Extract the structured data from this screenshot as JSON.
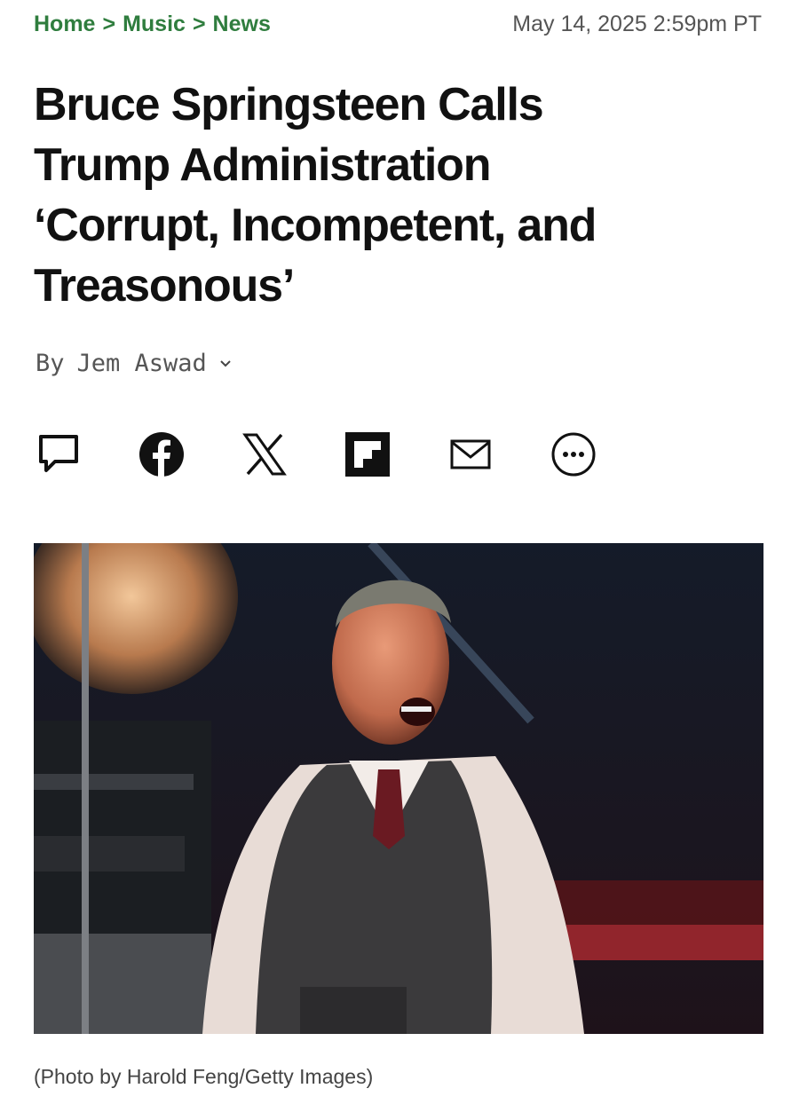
{
  "breadcrumb": {
    "items": [
      "Home",
      "Music",
      "News"
    ],
    "separator": ">"
  },
  "timestamp": "May 14, 2025 2:59pm PT",
  "headline": {
    "line1": "Bruce Springsteen Calls",
    "line2": "Trump Administration",
    "line3": "‘Corrupt, Incompetent, and",
    "line4": "Treasonous’"
  },
  "byline": {
    "prefix": "By",
    "author": "Jem Aswad",
    "icon": "chevron-down-icon"
  },
  "share": [
    {
      "name": "comment-icon"
    },
    {
      "name": "facebook-icon"
    },
    {
      "name": "x-icon"
    },
    {
      "name": "flipboard-icon"
    },
    {
      "name": "email-icon"
    },
    {
      "name": "more-icon"
    }
  ],
  "photo": {
    "caption": "(Photo by Harold Feng/Getty Images)"
  },
  "colors": {
    "breadcrumb": "#2f7d3e",
    "text": "#111111",
    "muted": "#555555"
  }
}
